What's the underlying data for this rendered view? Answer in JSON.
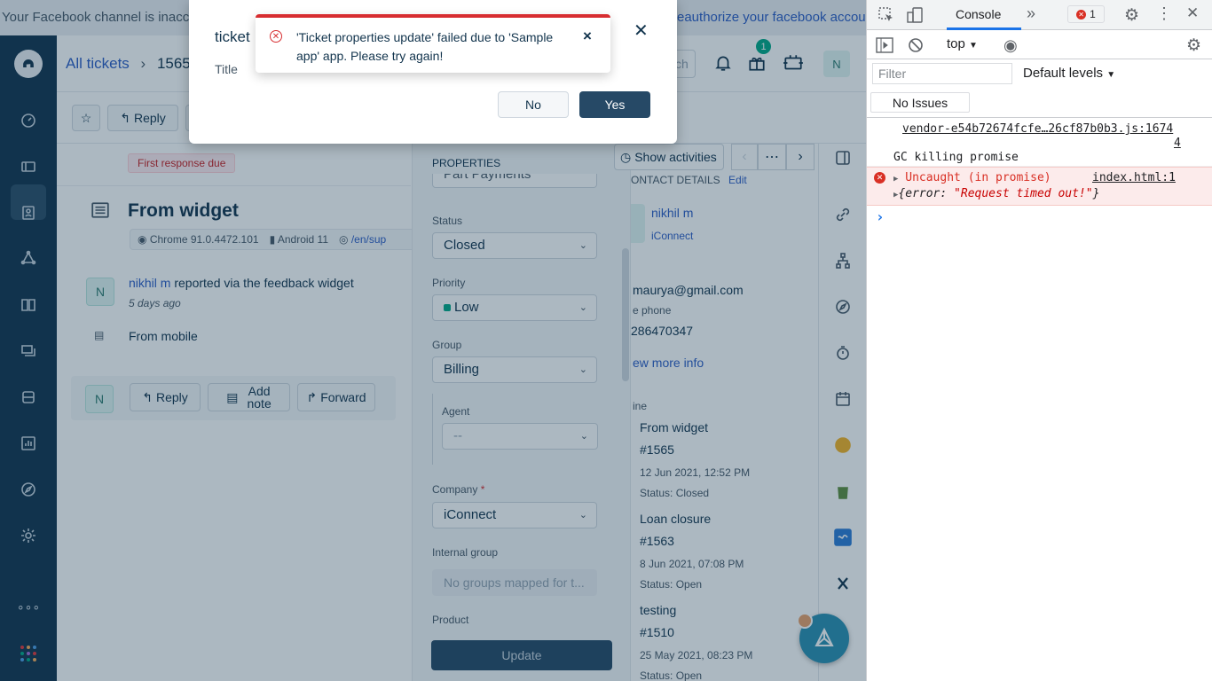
{
  "banner": {
    "text": "Your Facebook channel is inaccessible.",
    "link": "reauthorize your facebook account."
  },
  "header": {
    "crumb_root": "All tickets",
    "crumb_sep": "›",
    "ticket_id": "1565",
    "search_placeholder": "ch",
    "notif_count": "1",
    "avatar": "N"
  },
  "toolbar": {
    "reply": "Reply",
    "star": "☆"
  },
  "ticket": {
    "badge": "First response due",
    "subject": "From widget",
    "browser": "Chrome 91.0.4472.101",
    "os": "Android 11",
    "path": "/en/sup",
    "requester": "nikhil m",
    "reported": "reported via the feedback widget",
    "time": "5 days ago",
    "body": "From mobile",
    "avatar": "N",
    "actions": {
      "reply": "Reply",
      "add_note_1": "Add",
      "add_note_2": "note",
      "forward": "Forward"
    }
  },
  "properties": {
    "heading": "PROPERTIES",
    "partial": "Part Payments",
    "status_label": "Status",
    "status": "Closed",
    "priority_label": "Priority",
    "priority": "Low",
    "group_label": "Group",
    "group": "Billing",
    "agent_label": "Agent",
    "agent": "--",
    "company_label": "Company",
    "company_req": "*",
    "company": "iConnect",
    "internal_label": "Internal group",
    "internal": "No groups mapped for t...",
    "product_label": "Product",
    "update": "Update"
  },
  "contact": {
    "show_activities": "Show activities",
    "heading": "ONTACT DETAILS",
    "edit": "Edit",
    "name": "nikhil m",
    "company": "iConnect",
    "email": "maurya@gmail.com",
    "phone_label": "e phone",
    "phone": "286470347",
    "view_more": "ew more info",
    "timeline_label": "ine",
    "tickets": [
      {
        "title": "From widget",
        "id": "#1565",
        "date": "12 Jun 2021, 12:52 PM",
        "status": "Status: Closed"
      },
      {
        "title": "Loan closure",
        "id": "#1563",
        "date": "8 Jun 2021, 07:08 PM",
        "status": "Status: Open"
      },
      {
        "title": "testing",
        "id": "#1510",
        "date": "25 May 2021, 08:23 PM",
        "status": "Status: Open"
      }
    ]
  },
  "modal": {
    "title": "ticket",
    "field_label": "Title",
    "no": "No",
    "yes": "Yes",
    "close": "✕"
  },
  "toast": {
    "line1": "'Ticket properties update' failed due to 'Sample",
    "line2": "app' app. Please try again!",
    "close": "×"
  },
  "devtools": {
    "tab_console": "Console",
    "more": "»",
    "error_count": "1",
    "context": "top",
    "filter_placeholder": "Filter",
    "levels": "Default levels",
    "no_issues": "No Issues",
    "log_src_1": "vendor-e54b72674fcfe…26cf87b0b3.js:1674",
    "log_src_2": "4",
    "log_msg": "GC killing promise",
    "err_msg": "Uncaught (in promise)",
    "err_src": "index.html:1",
    "err_obj_key": "{error: ",
    "err_obj_val": "\"Request timed out!\"",
    "err_obj_end": "}",
    "prompt": "›"
  },
  "colors": {
    "nav": "#12344d",
    "primary": "#264966",
    "error": "#d72d30",
    "link": "#2c5cc5"
  }
}
